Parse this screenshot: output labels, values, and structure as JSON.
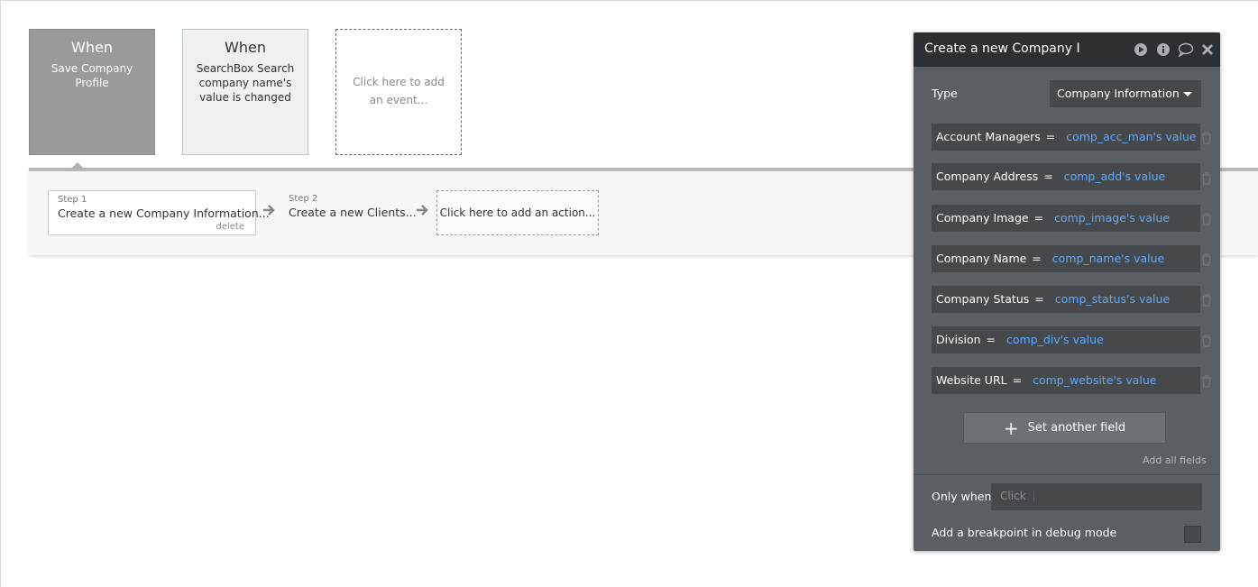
{
  "events": [
    {
      "when": "When",
      "description": "Save Company Profile"
    },
    {
      "when": "When",
      "description": "SearchBox Search company name's value is changed"
    }
  ],
  "add_event_label": "Click here to add an event...",
  "steps": [
    {
      "label": "Step 1",
      "title": "Create a new Company Information...",
      "delete": "delete"
    },
    {
      "label": "Step 2",
      "title": "Create a new Clients..."
    }
  ],
  "add_action_label": "Click here to add an action...",
  "panel": {
    "title": "Create a new Company I",
    "type_label": "Type",
    "type_value": "Company Information",
    "fields": [
      {
        "name": "Account Managers",
        "eq": "=",
        "value": "comp_acc_man's value"
      },
      {
        "name": "Company Address",
        "eq": "=",
        "value": "comp_add's value"
      },
      {
        "name": "Company Image",
        "eq": "=",
        "value": "comp_image's value"
      },
      {
        "name": "Company Name",
        "eq": "=",
        "value": "comp_name's value"
      },
      {
        "name": "Company Status",
        "eq": "=",
        "value": "comp_status's value"
      },
      {
        "name": "Division",
        "eq": "=",
        "value": "comp_div's value"
      },
      {
        "name": "Website URL",
        "eq": "=",
        "value": "comp_website's value"
      }
    ],
    "set_another_field": "Set another field",
    "add_all_fields": "Add all fields",
    "only_when_label": "Only when",
    "only_when_placeholder": "Click",
    "breakpoint_label": "Add a breakpoint in debug mode"
  },
  "colors": {
    "panel_bg": "#5a5f63",
    "panel_header": "#2d3033",
    "field_bg": "#46494c",
    "value_link": "#5fa8ff",
    "selected_event": "#9a9a9a"
  }
}
